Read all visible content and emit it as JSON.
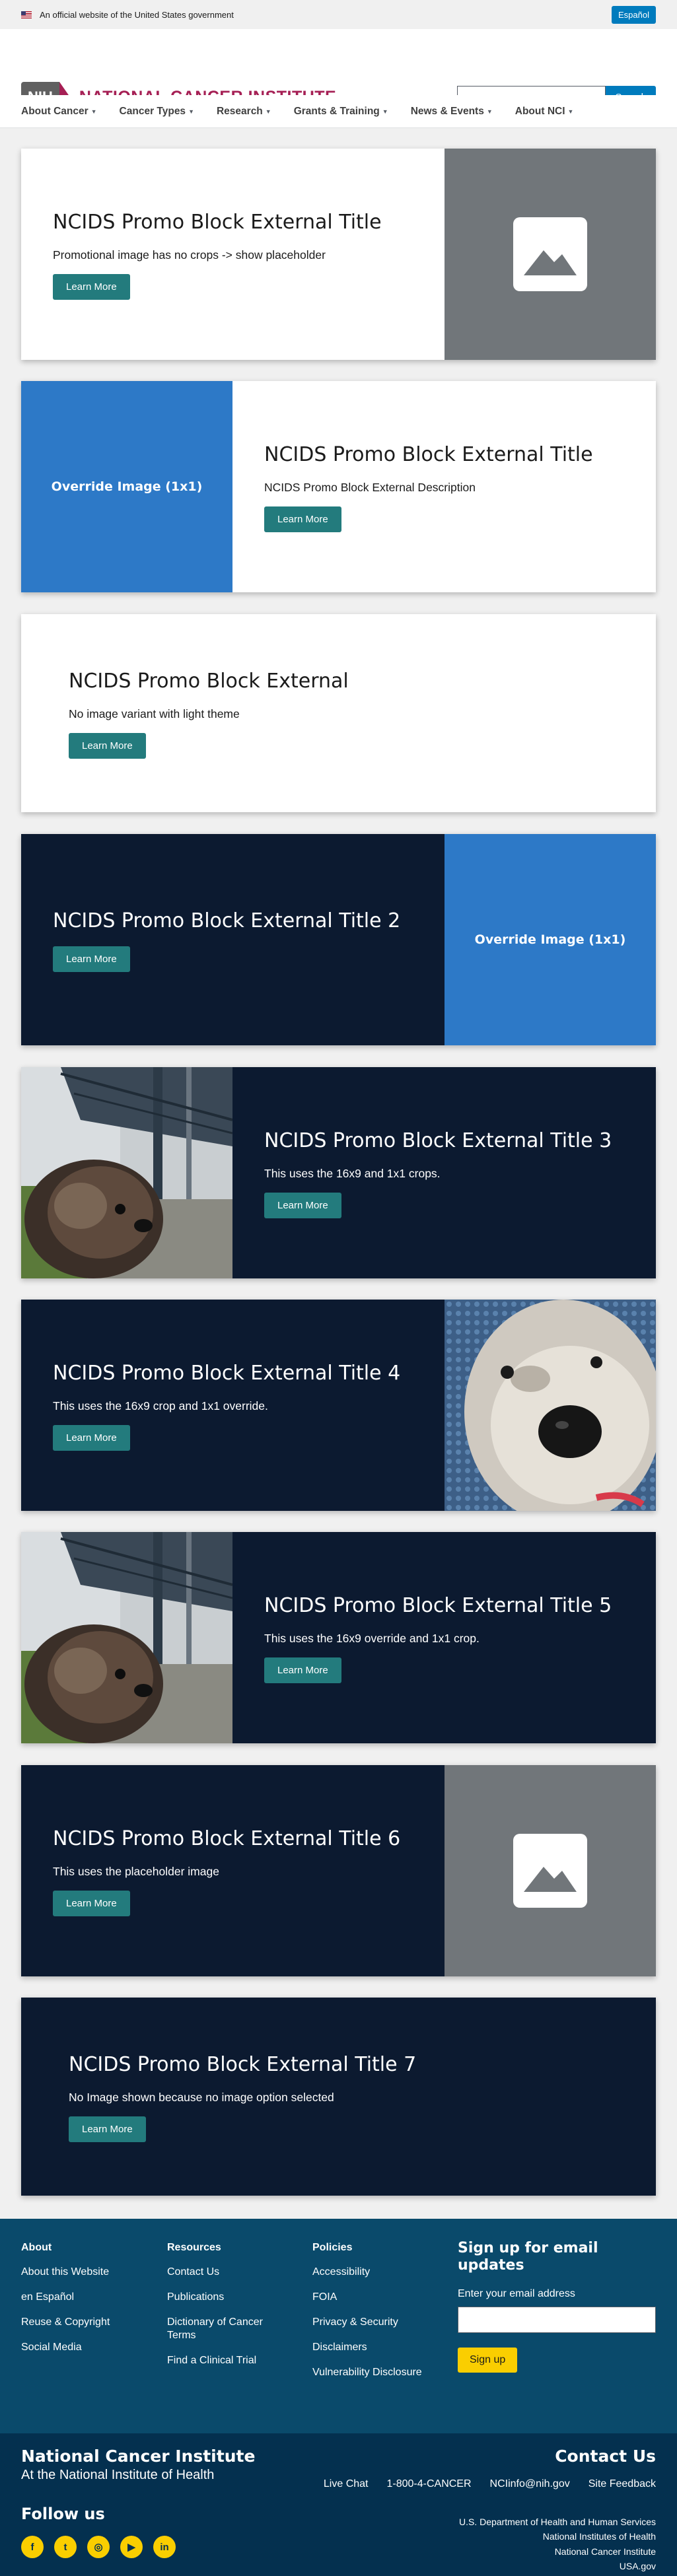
{
  "gov_banner": {
    "text": "An official website of the United States government",
    "lang_button": "Español"
  },
  "header": {
    "logo_short": "NIH",
    "logo_title": "NATIONAL CANCER INSTITUTE",
    "search_button": "Search",
    "search_placeholder": ""
  },
  "nav": [
    {
      "label": "About Cancer"
    },
    {
      "label": "Cancer Types"
    },
    {
      "label": "Research"
    },
    {
      "label": "Grants & Training"
    },
    {
      "label": "News & Events"
    },
    {
      "label": "About NCI"
    }
  ],
  "promos": [
    {
      "title": "NCIDS Promo Block External Title",
      "desc": "Promotional image has no crops -> show placeholder",
      "button": "Learn More",
      "theme": "light",
      "image": "placeholder",
      "image_side": "right"
    },
    {
      "title": "NCIDS Promo Block External Title",
      "desc": "NCIDS Promo Block External Description",
      "button": "Learn More",
      "theme": "light",
      "image": "override",
      "image_text": "Override Image (1x1)",
      "image_side": "left"
    },
    {
      "title": "NCIDS Promo Block External",
      "desc": "No image variant with light theme",
      "button": "Learn More",
      "theme": "light",
      "image": "none"
    },
    {
      "title": "NCIDS Promo Block External Title 2",
      "desc": "",
      "button": "Learn More",
      "theme": "dark",
      "image": "override",
      "image_text": "Override Image (1x1)",
      "image_side": "right"
    },
    {
      "title": "NCIDS Promo Block External Title 3",
      "desc": "This uses the 16x9 and 1x1 crops.",
      "button": "Learn More",
      "theme": "dark",
      "image": "dog-bridge",
      "image_side": "left"
    },
    {
      "title": "NCIDS Promo Block External Title 4",
      "desc": "This uses the 16x9 crop and 1x1 override.",
      "button": "Learn More",
      "theme": "dark",
      "image": "dog-closeup",
      "image_side": "right"
    },
    {
      "title": "NCIDS Promo Block External Title 5",
      "desc": "This uses the 16x9 override and 1x1 crop.",
      "button": "Learn More",
      "theme": "dark",
      "image": "dog-bridge",
      "image_side": "left"
    },
    {
      "title": "NCIDS Promo Block External Title 6",
      "desc": "This uses the placeholder image",
      "button": "Learn More",
      "theme": "dark",
      "image": "placeholder",
      "image_side": "right"
    },
    {
      "title": "NCIDS Promo Block External Title 7",
      "desc": "No Image shown because no image option selected",
      "button": "Learn More",
      "theme": "dark",
      "image": "none"
    }
  ],
  "footer": {
    "about": {
      "heading": "About",
      "links": [
        "About this Website",
        "en Español",
        "Reuse & Copyright",
        "Social Media"
      ]
    },
    "resources": {
      "heading": "Resources",
      "links": [
        "Contact Us",
        "Publications",
        "Dictionary of Cancer Terms",
        "Find a Clinical Trial"
      ]
    },
    "policies": {
      "heading": "Policies",
      "links": [
        "Accessibility",
        "FOIA",
        "Privacy & Security",
        "Disclaimers",
        "Vulnerability Disclosure"
      ]
    },
    "signup": {
      "heading": "Sign up for email updates",
      "label": "Enter your email address",
      "button": "Sign up"
    }
  },
  "footer_bottom": {
    "title": "National Cancer Institute",
    "subtitle": "At the National Institute of Health",
    "follow": "Follow us",
    "social": [
      "facebook-icon",
      "twitter-icon",
      "instagram-icon",
      "youtube-icon",
      "linkedin-icon"
    ],
    "contact_title": "Contact Us",
    "contact_links": [
      "Live Chat",
      "1-800-4-CANCER",
      "NCIinfo@nih.gov",
      "Site Feedback"
    ],
    "agencies": [
      "U.S. Department of Health and Human Services",
      "National Institutes of Health",
      "National Cancer Institute",
      "USA.gov"
    ]
  },
  "colors": {
    "dark_bg": "#0c1a30",
    "button": "#237b7d",
    "override": "#2d79c7",
    "footer": "#0a4a6b",
    "footer_bottom": "#04304f",
    "brand": "#a51f54"
  }
}
